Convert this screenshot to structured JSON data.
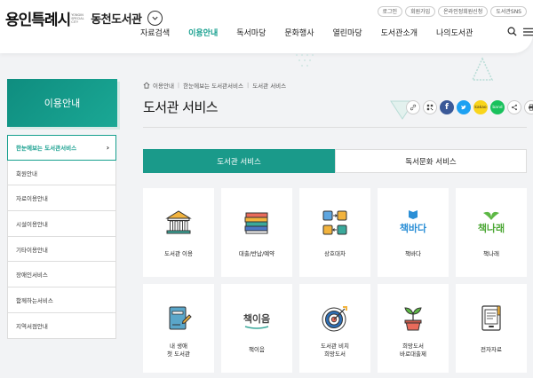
{
  "brand": {
    "city_logo": "용인특례시",
    "city_logo_sub": "YONGIN SPECIAL CITY",
    "library_name": "동천도서관"
  },
  "utility_links": [
    {
      "label": "로그인"
    },
    {
      "label": "회원가입"
    },
    {
      "label": "온라인정회원신청"
    },
    {
      "label": "도서관SNS"
    }
  ],
  "gnb": [
    {
      "label": "자료검색"
    },
    {
      "label": "이용안내"
    },
    {
      "label": "독서마당"
    },
    {
      "label": "문화행사"
    },
    {
      "label": "열린마당"
    },
    {
      "label": "도서관소개"
    },
    {
      "label": "나의도서관"
    }
  ],
  "sidebar": {
    "title": "이용안내",
    "items": [
      {
        "label": "한눈에보는 도서관서비스"
      },
      {
        "label": "회원안내"
      },
      {
        "label": "자료이용안내"
      },
      {
        "label": "시설이용안내"
      },
      {
        "label": "기타이용안내"
      },
      {
        "label": "장애인서비스"
      },
      {
        "label": "함께하는서비스"
      },
      {
        "label": "지역서점안내"
      }
    ]
  },
  "breadcrumb": [
    "이용안내",
    "한눈에보는 도서관서비스",
    "도서관 서비스"
  ],
  "page_title": "도서관 서비스",
  "share": {
    "facebook": "f",
    "kakaostory": "kakao",
    "naver_band": "band"
  },
  "tabs": [
    {
      "label": "도서관 서비스"
    },
    {
      "label": "독서문화 서비스"
    }
  ],
  "services": [
    {
      "label": "도서관 이용",
      "icon": "library-building-icon"
    },
    {
      "label": "대출/반납/예약",
      "icon": "book-stack-icon"
    },
    {
      "label": "상호대차",
      "icon": "exchange-icon"
    },
    {
      "label": "책바다",
      "icon": "chaekbada-logo-icon",
      "logo_text": "책바다"
    },
    {
      "label": "책나래",
      "icon": "chaeknarae-logo-icon",
      "logo_text": "책나래"
    },
    {
      "label": "내 생애\n첫 도서관",
      "icon": "first-library-book-icon"
    },
    {
      "label": "책이음",
      "icon": "chaekieum-logo-icon",
      "logo_text": "책이음"
    },
    {
      "label": "도서관 비치\n희망도서",
      "icon": "target-icon"
    },
    {
      "label": "희망도서\n바로대출제",
      "icon": "plant-icon"
    },
    {
      "label": "전자자료",
      "icon": "ebook-icon"
    }
  ],
  "colors": {
    "accent": "#169f8e",
    "tab_active": "#1a9a8a"
  }
}
